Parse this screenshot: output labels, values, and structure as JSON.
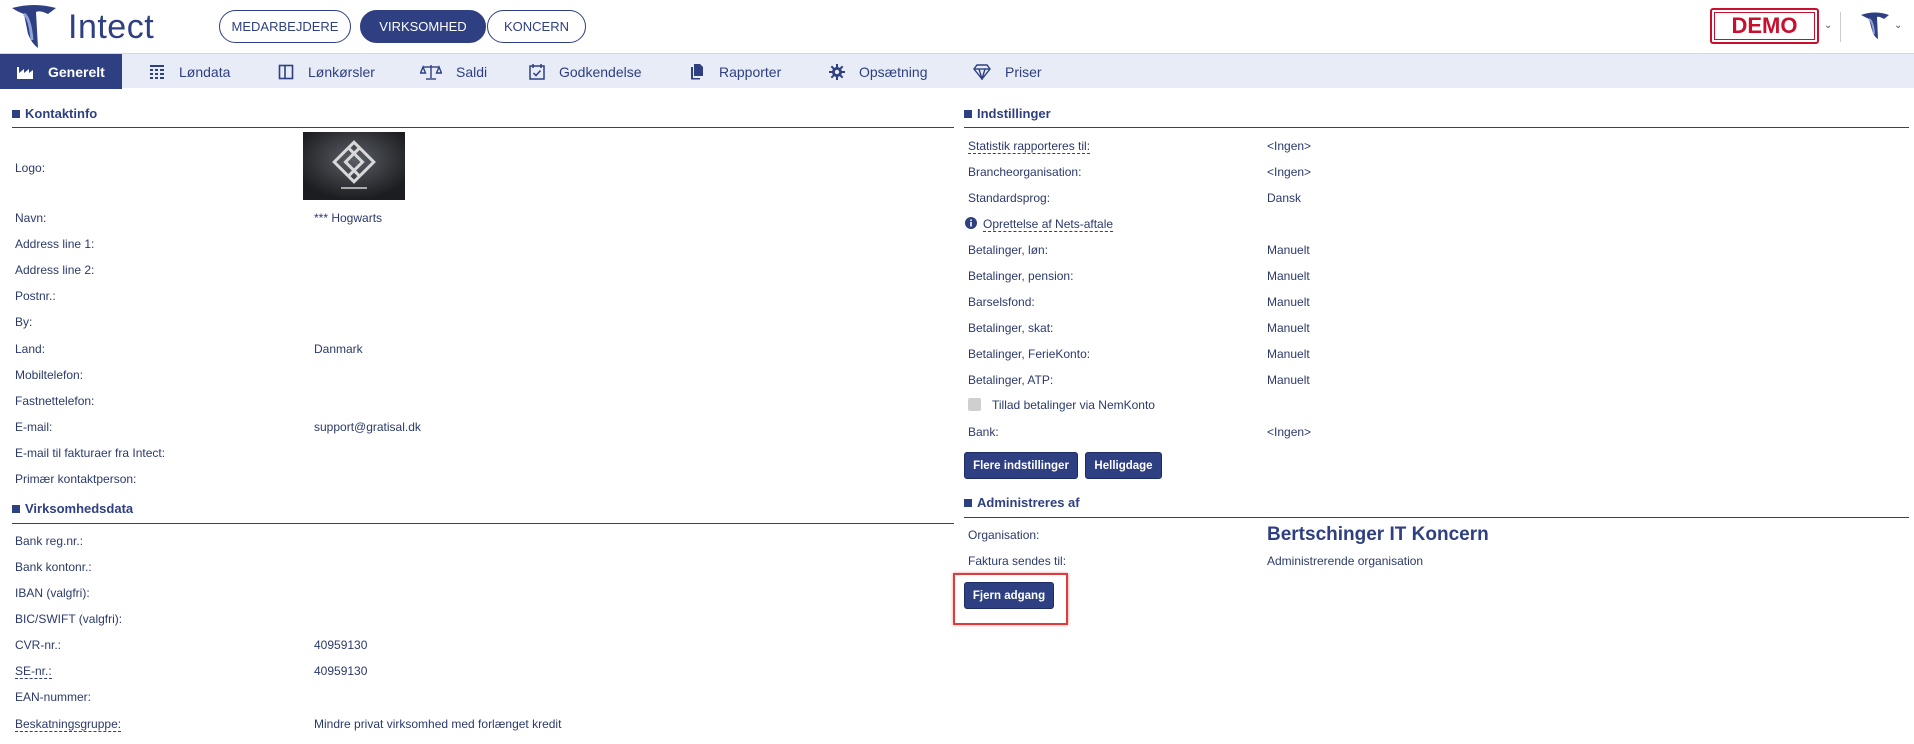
{
  "header": {
    "logo_text": "Intect",
    "tabs": [
      {
        "label": "MEDARBEJDERE",
        "active": false
      },
      {
        "label": "VIRKSOMHED",
        "active": true
      },
      {
        "label": "KONCERN",
        "active": false
      }
    ],
    "demo_badge": "DEMO",
    "accent_color": "#2e3f82",
    "demo_color": "#c8102e"
  },
  "nav": {
    "items": [
      {
        "label": "Generelt",
        "icon": "factory-icon",
        "active": true
      },
      {
        "label": "Løndata",
        "icon": "grid-icon",
        "active": false
      },
      {
        "label": "Lønkørsler",
        "icon": "columns-icon",
        "active": false
      },
      {
        "label": "Saldi",
        "icon": "scale-icon",
        "active": false
      },
      {
        "label": "Godkendelse",
        "icon": "calendar-check-icon",
        "active": false
      },
      {
        "label": "Rapporter",
        "icon": "documents-icon",
        "active": false
      },
      {
        "label": "Opsætning",
        "icon": "gear-icon",
        "active": false
      },
      {
        "label": "Priser",
        "icon": "diamond-icon",
        "active": false
      }
    ]
  },
  "contact": {
    "title": "Kontaktinfo",
    "logo_label": "Logo:",
    "rows": [
      {
        "label": "Navn:",
        "value": "*** Hogwarts"
      },
      {
        "label": "Address line 1:",
        "value": ""
      },
      {
        "label": "Address line 2:",
        "value": ""
      },
      {
        "label": "Postnr.:",
        "value": ""
      },
      {
        "label": "By:",
        "value": ""
      },
      {
        "label": "Land:",
        "value": "Danmark"
      },
      {
        "label": "Mobiltelefon:",
        "value": ""
      },
      {
        "label": "Fastnettelefon:",
        "value": ""
      },
      {
        "label": "E-mail:",
        "value": "support@gratisal.dk"
      },
      {
        "label": "E-mail til fakturaer fra Intect:",
        "value": ""
      },
      {
        "label": "Primær kontaktperson:",
        "value": ""
      }
    ]
  },
  "company": {
    "title": "Virksomhedsdata",
    "rows": [
      {
        "label": "Bank reg.nr.:",
        "value": ""
      },
      {
        "label": "Bank kontonr.:",
        "value": ""
      },
      {
        "label": "IBAN (valgfri):",
        "value": ""
      },
      {
        "label": "BIC/SWIFT (valgfri):",
        "value": ""
      },
      {
        "label": "CVR-nr.:",
        "value": "40959130"
      },
      {
        "label": "SE-nr.:",
        "value": "40959130"
      },
      {
        "label": "EAN-nummer:",
        "value": ""
      },
      {
        "label": "Beskatningsgruppe:",
        "value": "Mindre privat virksomhed med forlænget kredit"
      }
    ]
  },
  "settings": {
    "title": "Indstillinger",
    "rows": [
      {
        "label": "Statistik rapporteres til:",
        "value": "<Ingen>"
      },
      {
        "label": "Brancheorganisation:",
        "value": "<Ingen>"
      },
      {
        "label": "Standardsprog:",
        "value": "Dansk"
      }
    ],
    "nets_link": "Oprettelse af Nets-aftale",
    "payment_rows": [
      {
        "label": "Betalinger, løn:",
        "value": "Manuelt"
      },
      {
        "label": "Betalinger, pension:",
        "value": "Manuelt"
      },
      {
        "label": "Barselsfond:",
        "value": "Manuelt"
      },
      {
        "label": "Betalinger, skat:",
        "value": "Manuelt"
      },
      {
        "label": "Betalinger, FerieKonto:",
        "value": "Manuelt"
      },
      {
        "label": "Betalinger, ATP:",
        "value": "Manuelt"
      }
    ],
    "nemkonto_checkbox": "Tillad betalinger via NemKonto",
    "bank_label": "Bank:",
    "bank_value": "<Ingen>",
    "more_settings_button": "Flere indstillinger",
    "holidays_button": "Helligdage"
  },
  "admin": {
    "title": "Administreres af",
    "org_label": "Organisation:",
    "org_value": "Bertschinger IT Koncern",
    "invoice_label": "Faktura sendes til:",
    "invoice_value": "Administrerende organisation",
    "remove_access_button": "Fjern adgang"
  }
}
